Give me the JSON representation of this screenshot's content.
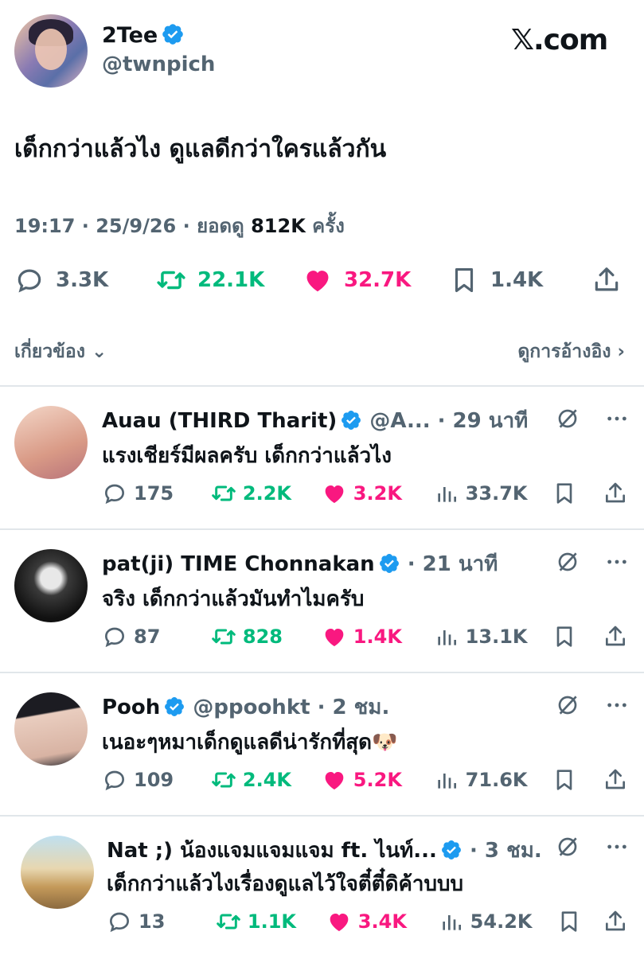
{
  "header": {
    "display_name": "2Tee",
    "handle": "@twnpich",
    "brand": "𝕏.com"
  },
  "tweet": {
    "text": "เด็กกว่าแล้วไง ดูแลดีกว่าใครแล้วกัน",
    "meta_prefix": "19:17 · 25/9/26 · ยอดดู ",
    "views": "812K",
    "views_suffix": " ครั้ง"
  },
  "stats": {
    "replies": "3.3K",
    "retweets": "22.1K",
    "likes": "32.7K",
    "bookmarks": "1.4K"
  },
  "related_label": "เกี่ยวข้อง",
  "quotes_label": "ดูการอ้างอิง",
  "replies": [
    {
      "name": "Auau (THIRD Tharit)",
      "handle_time": "@A... · 29 นาที",
      "text": "แรงเชียร์มีผลครับ เด็กกว่าแล้วไง",
      "replies": "175",
      "retweets": "2.2K",
      "likes": "3.2K",
      "views": "33.7K"
    },
    {
      "name": "pat(ji) TIME Chonnakan",
      "handle_time": "· 21 นาที",
      "text": "จริง เด็กกว่าแล้วมันทำไมครับ",
      "replies": "87",
      "retweets": "828",
      "likes": "1.4K",
      "views": "13.1K"
    },
    {
      "name": "Pooh",
      "handle_time": "@ppoohkt · 2 ชม.",
      "text": "เนอะๆหมาเด็กดูแลดีน่ารักที่สุด🐶",
      "replies": "109",
      "retweets": "2.4K",
      "likes": "5.2K",
      "views": "71.6K"
    },
    {
      "name": "Nat ;) น้องแจมแจมแจม ft. ไนท์...",
      "handle_time": "· 3 ชม.",
      "text": "เด็กกว่าแล้วไงเรื่องดูแลไว้ใจตี๋ตี๋ดิค้าบบบ",
      "replies": "13",
      "retweets": "1.1K",
      "likes": "3.4K",
      "views": "54.2K"
    }
  ],
  "colors": {
    "verified": "#1d9bf0",
    "retweet": "#00ba7c",
    "like": "#f91880",
    "muted": "#536471"
  }
}
